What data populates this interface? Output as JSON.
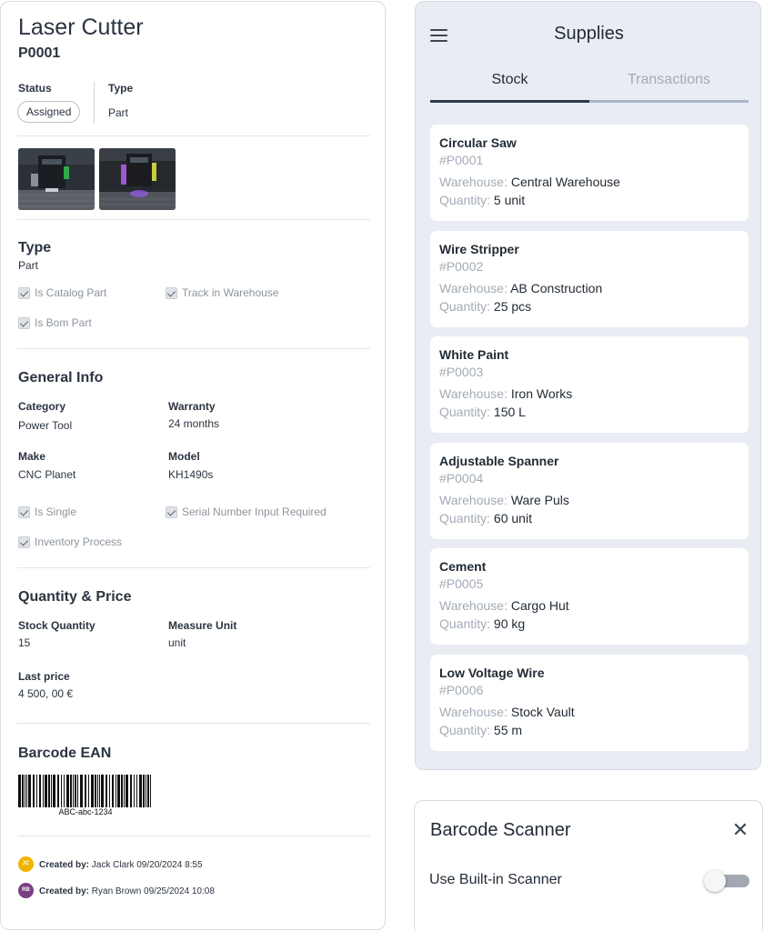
{
  "detail": {
    "title": "Laser Cutter",
    "code": "P0001",
    "status_label": "Status",
    "status_value": "Assigned",
    "type_label": "Type",
    "type_value": "Part",
    "type_section": {
      "heading": "Type",
      "value": "Part",
      "checks": [
        "Is Catalog Part",
        "Track in Warehouse",
        "Is Bom Part"
      ]
    },
    "general": {
      "heading": "General Info",
      "category_label": "Category",
      "category_value": "Power Tool",
      "warranty_label": "Warranty",
      "warranty_value": "24 months",
      "make_label": "Make",
      "make_value": "CNC Planet",
      "model_label": "Model",
      "model_value": "KH1490s",
      "checks": [
        "Is Single",
        "Serial Number Input Required",
        "Inventory Process"
      ]
    },
    "qty": {
      "heading": "Quantity & Price",
      "stock_label": "Stock Quantity",
      "stock_value": "15",
      "unit_label": "Measure Unit",
      "unit_value": "unit",
      "price_label": "Last price",
      "price_value": "4 500, 00 €"
    },
    "barcode": {
      "heading": "Barcode EAN",
      "text": "ABC-abc-1234"
    },
    "history": [
      {
        "initials": "JC",
        "label": "Created by:",
        "text": "Jack Clark 09/20/2024  8:55",
        "color": "#f0b400"
      },
      {
        "initials": "RB",
        "label": "Created by:",
        "text": "Ryan Brown 09/25/2024  10:08",
        "color": "#7a3f82"
      }
    ]
  },
  "supplies": {
    "title": "Supplies",
    "tabs": [
      "Stock",
      "Transactions"
    ],
    "warehouse_label": "Warehouse: ",
    "quantity_label": "Quantity: ",
    "items": [
      {
        "name": "Circular Saw",
        "id": "#P0001",
        "warehouse": "Central Warehouse",
        "quantity": "5 unit"
      },
      {
        "name": "Wire Stripper",
        "id": "#P0002",
        "warehouse": "AB Construction",
        "quantity": "25 pcs"
      },
      {
        "name": "White Paint",
        "id": "#P0003",
        "warehouse": "Iron Works",
        "quantity": "150 L"
      },
      {
        "name": "Adjustable Spanner",
        "id": "#P0004",
        "warehouse": "Ware Puls",
        "quantity": "60 unit"
      },
      {
        "name": "Cement",
        "id": "#P0005",
        "warehouse": "Cargo Hut",
        "quantity": "90 kg"
      },
      {
        "name": "Low Voltage Wire",
        "id": "#P0006",
        "warehouse": "Stock Vault",
        "quantity": "55 m"
      }
    ]
  },
  "scanner": {
    "title": "Barcode Scanner",
    "label": "Use Built-in Scanner",
    "enabled": false
  }
}
